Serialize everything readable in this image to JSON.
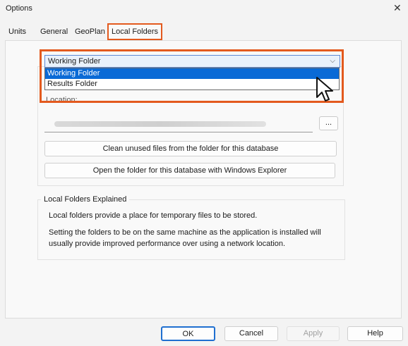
{
  "window": {
    "title": "Options"
  },
  "tabs": [
    {
      "label": "Units"
    },
    {
      "label": "General"
    },
    {
      "label": "GeoPlan"
    },
    {
      "label": "Local Folders",
      "active": true
    }
  ],
  "folder_combo": {
    "selected": "Working Folder",
    "options": [
      "Working Folder",
      "Results Folder"
    ],
    "highlighted": "Working Folder"
  },
  "location_label": "Location:",
  "browse_label": "...",
  "buttons": {
    "clean": "Clean unused files from the folder for this database",
    "open": "Open the folder for this database with Windows Explorer"
  },
  "explained": {
    "title": "Local Folders Explained",
    "p1": "Local folders provide a place for temporary files to be stored.",
    "p2": "Setting the folders to be on the same machine as the application is installed will usually provide improved performance over using a network location."
  },
  "footer": {
    "ok": "OK",
    "cancel": "Cancel",
    "apply": "Apply",
    "help": "Help"
  },
  "colors": {
    "highlight_border": "#e35a1e",
    "selection": "#0a6ad6",
    "ok_border": "#1f6fd0"
  }
}
